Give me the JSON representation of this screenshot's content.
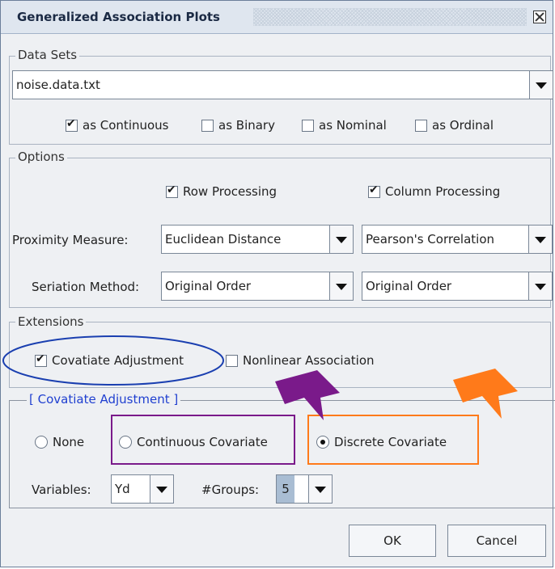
{
  "window": {
    "title": "Generalized Association Plots"
  },
  "data_sets": {
    "legend": "Data Sets",
    "file": "noise.data.txt",
    "types": [
      {
        "label": "as Continuous",
        "checked": true
      },
      {
        "label": "as Binary",
        "checked": false
      },
      {
        "label": "as Nominal",
        "checked": false
      },
      {
        "label": "as Ordinal",
        "checked": false
      }
    ]
  },
  "options": {
    "legend": "Options",
    "row_processing": {
      "label": "Row Processing",
      "checked": true
    },
    "column_processing": {
      "label": "Column Processing",
      "checked": true
    },
    "proximity_label": "Proximity Measure:",
    "proximity_row": "Euclidean Distance",
    "proximity_col": "Pearson's Correlation",
    "seriation_label": "Seriation Method:",
    "seriation_row": "Original Order",
    "seriation_col": "Original Order"
  },
  "extensions": {
    "legend": "Extensions",
    "covariate": {
      "label": "Covatiate Adjustment",
      "checked": true
    },
    "nonlinear": {
      "label": "Nonlinear Association",
      "checked": false
    }
  },
  "covariate_adjustment": {
    "legend": "[ Covatiate Adjustment ]",
    "options": [
      {
        "label": "None",
        "selected": false
      },
      {
        "label": "Continuous Covariate",
        "selected": false
      },
      {
        "label": "Discrete Covariate",
        "selected": true
      }
    ],
    "variables_label": "Variables:",
    "variables_value": "Yd",
    "groups_label": "#Groups:",
    "groups_value": "5"
  },
  "buttons": {
    "ok": "OK",
    "cancel": "Cancel"
  },
  "annotations": {
    "ellipse_color": "#1a3fb0",
    "purple": "#7a1a8a",
    "orange": "#ff7a1a"
  }
}
